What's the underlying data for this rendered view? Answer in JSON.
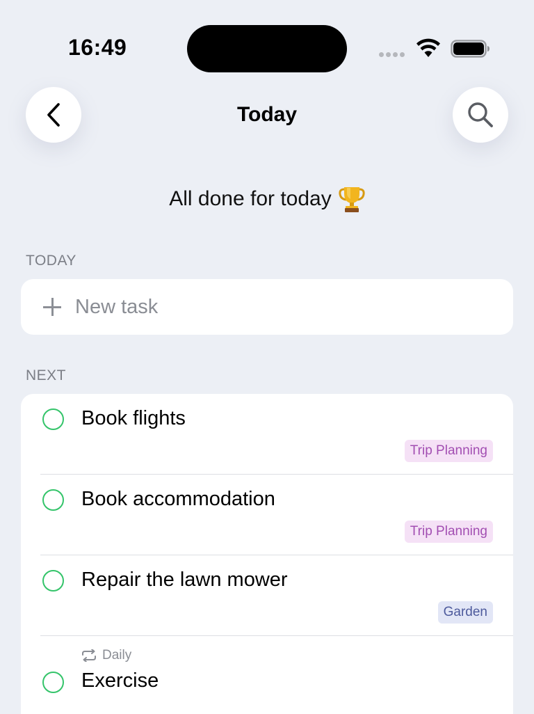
{
  "status_bar": {
    "time": "16:49"
  },
  "nav": {
    "title": "Today",
    "back_icon": "chevron-left-icon",
    "search_icon": "search-icon"
  },
  "banner": {
    "text": "All done for today",
    "icon": "trophy-icon"
  },
  "sections": {
    "today_label": "TODAY",
    "next_label": "NEXT"
  },
  "new_task": {
    "placeholder": "New task",
    "icon": "plus-icon"
  },
  "tasks": [
    {
      "title": "Book flights",
      "tag": "Trip Planning",
      "tag_color": "#a24eb2",
      "tag_bg": "#f5e1f6"
    },
    {
      "title": "Book accommodation",
      "tag": "Trip Planning",
      "tag_color": "#a24eb2",
      "tag_bg": "#f5e1f6"
    },
    {
      "title": "Repair the lawn mower",
      "tag": "Garden",
      "tag_color": "#4d5a9c",
      "tag_bg": "#e2e6f6"
    },
    {
      "title": "Exercise",
      "repeat": "Daily",
      "repeat_icon": "repeat-icon"
    }
  ],
  "colors": {
    "background": "#eceff5",
    "check_circle": "#34c46a",
    "secondary_text": "#7b7e86"
  }
}
